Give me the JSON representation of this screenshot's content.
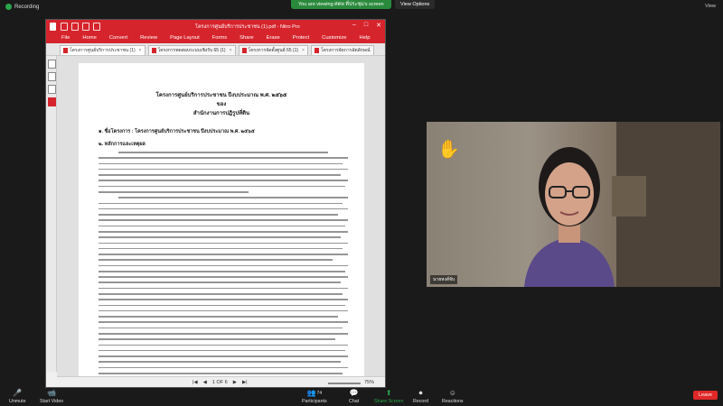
{
  "zoom_top": {
    "recording": "Recording",
    "viewing_notice": "You are viewing ศตพ ที่ประชุม's screen",
    "view_options": "View Options",
    "view": "View"
  },
  "nitro": {
    "window_title": "โครงการศูนย์บริการประชาชน (1).pdf - Nitro Pro",
    "menu": [
      "File",
      "Home",
      "Convert",
      "Review",
      "Page Layout",
      "Forms",
      "Share",
      "Erase",
      "Protect",
      "Customize",
      "Help"
    ],
    "tabs": [
      {
        "label": "โครงการศูนย์บริการประชาชน (1)"
      },
      {
        "label": "โครงการทดสอบระบบเชิงรับ 65 (1)"
      },
      {
        "label": "โครงการจัดตั้งศูนย์ 65 (1)"
      },
      {
        "label": "โครงการจัดการอัตลักษณ์"
      }
    ],
    "page": {
      "title_line1": "โครงการศูนย์บริการประชาชน ปีงบประมาณ พ.ศ. ๒๕๖๕",
      "title_line2": "ของ",
      "title_line3": "สำนักงานการปฏิรูปที่ดิน",
      "section1": "๑. ชื่อโครงการ : โครงการศูนย์บริการประชาชน ปีงบประมาณ พ.ศ. ๒๕๖๕",
      "section2": "๒. หลักการและเหตุผล"
    },
    "status": {
      "page_indicator": "1 OF 6",
      "zoom": "75%"
    }
  },
  "video": {
    "participant_name": "นายหงส์จับ"
  },
  "toolbar": {
    "unmute": "Unmute",
    "start_video": "Start Video",
    "participants": "Participants",
    "participants_count": "74",
    "chat": "Chat",
    "share_screen": "Share Screen",
    "record": "Record",
    "reactions": "Reactions",
    "leave": "Leave"
  }
}
